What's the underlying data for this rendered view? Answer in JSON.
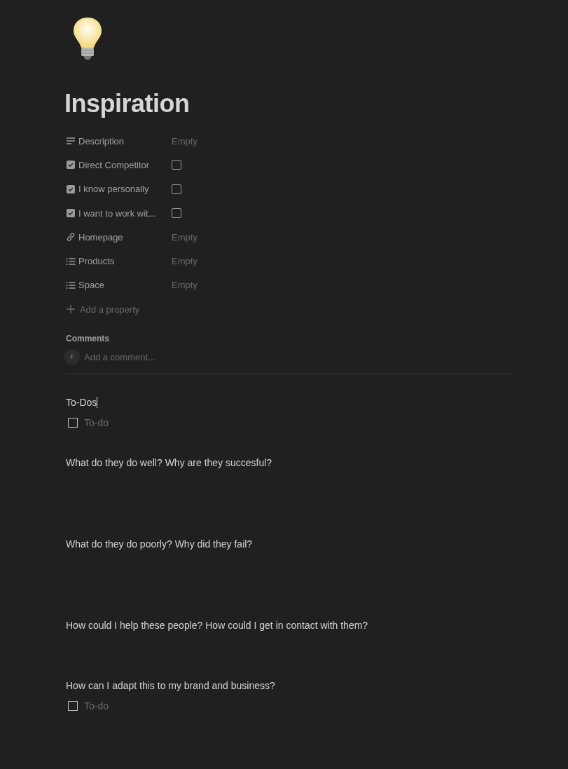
{
  "page": {
    "title": "Inspiration"
  },
  "properties": [
    {
      "kind": "text",
      "label": "Description",
      "value": "Empty"
    },
    {
      "kind": "checkbox",
      "label": "Direct Competitor",
      "checked": false
    },
    {
      "kind": "checkbox",
      "label": "I know personally",
      "checked": false
    },
    {
      "kind": "checkbox",
      "label": "I want to work wit...",
      "checked": false
    },
    {
      "kind": "url",
      "label": "Homepage",
      "value": "Empty"
    },
    {
      "kind": "multi_select",
      "label": "Products",
      "value": "Empty"
    },
    {
      "kind": "multi_select",
      "label": "Space",
      "value": "Empty"
    }
  ],
  "add_property": "Add a property",
  "comments": {
    "heading": "Comments",
    "avatar": "F",
    "placeholder": "Add a comment..."
  },
  "blocks": [
    {
      "kind": "text",
      "text": "To-Dos",
      "focused": true
    },
    {
      "kind": "todo",
      "placeholder": "To-do",
      "checked": false
    },
    {
      "kind": "text",
      "text": "What do they do well? Why are they succesful?",
      "focused": false
    },
    {
      "kind": "text",
      "text": "What do they do poorly? Why did they fail?",
      "focused": false
    },
    {
      "kind": "text",
      "text": "How could I help these people? How could I get in contact with them?",
      "focused": false
    },
    {
      "kind": "text",
      "text": "How can I adapt this to my brand and business?",
      "focused": false
    },
    {
      "kind": "todo",
      "placeholder": "To-do",
      "checked": false
    }
  ]
}
